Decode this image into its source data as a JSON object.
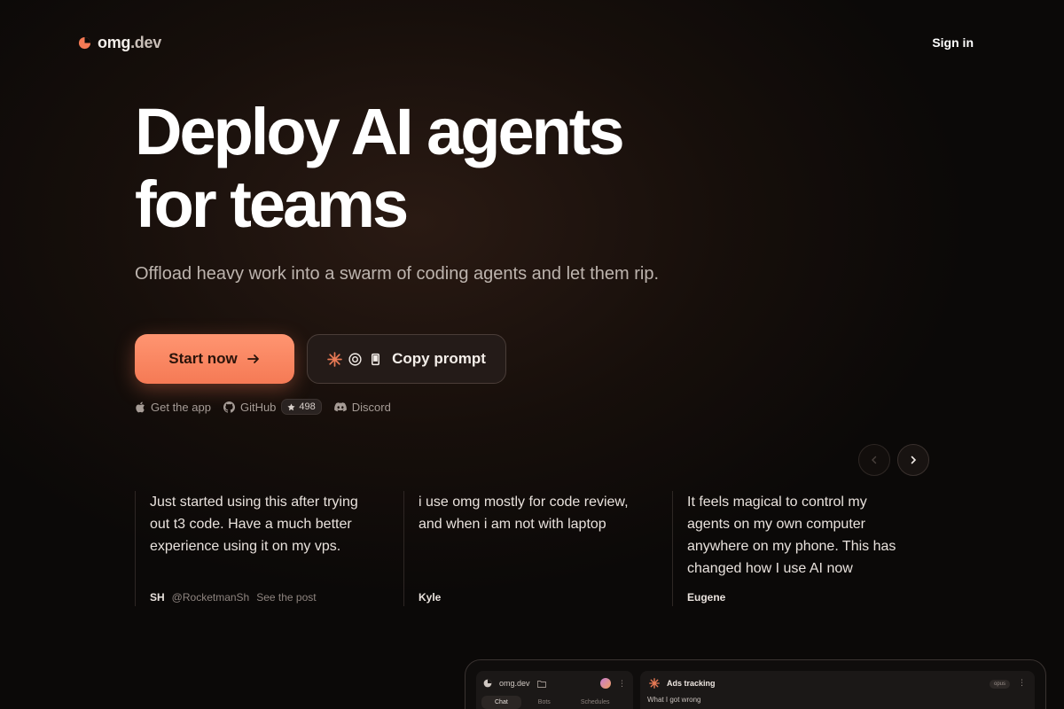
{
  "nav": {
    "logo_text": "omg",
    "logo_suffix": ".dev",
    "signin": "Sign in",
    "accent": "#f57a55"
  },
  "hero": {
    "title_line1": "Deploy AI agents",
    "title_line2": "for teams",
    "subtitle": "Offload heavy work into a swarm of coding agents and let them rip."
  },
  "cta": {
    "start": "Start now",
    "copy_prompt": "Copy prompt"
  },
  "links": {
    "app": "Get the app",
    "github": "GitHub",
    "github_stars": "498",
    "discord": "Discord"
  },
  "testimonials": [
    {
      "quote": "Just started using this after trying out t3 code. Have a much better experience using it on my vps.",
      "initials": "SH",
      "handle": "@RocketmanSh",
      "link": "See the post"
    },
    {
      "quote": "i use omg mostly for code review, and when i am not with laptop",
      "name": "Kyle"
    },
    {
      "quote": "It feels magical to control my agents on my own computer anywhere on my phone. This has changed how I use AI now",
      "name": "Eugene"
    }
  ],
  "preview": {
    "app_name": "omg.dev",
    "tabs": [
      "Chat",
      "Bots",
      "Schedules"
    ],
    "chat_title": "Ads tracking",
    "model_badge": "opus",
    "message_preview": "What I got wrong"
  }
}
